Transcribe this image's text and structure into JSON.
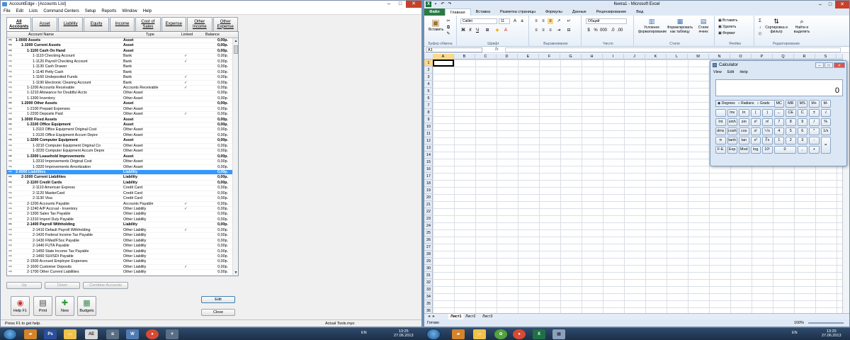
{
  "accountedge": {
    "title": "AccountEdge - [Accounts List]",
    "window_buttons": [
      "–",
      "□",
      "✕"
    ],
    "menu": [
      "File",
      "Edit",
      "Lists",
      "Command Centers",
      "Setup",
      "Reports",
      "Window",
      "Help"
    ],
    "tabs": [
      {
        "label": "All Accounts",
        "active": true
      },
      {
        "label": "Asset"
      },
      {
        "label": "Liability"
      },
      {
        "label": "Equity"
      },
      {
        "label": "Income"
      },
      {
        "label": "Cost of Sales"
      },
      {
        "label": "Expense"
      },
      {
        "label": "Other Income"
      },
      {
        "label": "Other Expense"
      }
    ],
    "columns": {
      "name": "Account Name",
      "type": "Type",
      "linked": "Linked",
      "balance": "Balance"
    },
    "rows": [
      {
        "name": "1-0000   Assets",
        "type": "Asset",
        "linked": "",
        "balance": "0,00p.",
        "level": 0,
        "bold": true
      },
      {
        "name": "1-1000   Current Assets",
        "type": "Asset",
        "linked": "",
        "balance": "0,00p.",
        "level": 1,
        "bold": true
      },
      {
        "name": "1-1100   Cash On Hand",
        "type": "Asset",
        "linked": "",
        "balance": "0,00p.",
        "level": 2,
        "bold": true
      },
      {
        "name": "1-1110      Checking Account",
        "type": "Bank",
        "linked": "✓",
        "balance": "0,00p.",
        "level": 3
      },
      {
        "name": "1-1120      Payroll Checking Account",
        "type": "Bank",
        "linked": "✓",
        "balance": "0,00p.",
        "level": 3
      },
      {
        "name": "1-1130      Cash Drawer",
        "type": "Bank",
        "linked": "",
        "balance": "0,00p.",
        "level": 3
      },
      {
        "name": "1-1140      Petty Cash",
        "type": "Bank",
        "linked": "",
        "balance": "0,00p.",
        "level": 3
      },
      {
        "name": "1-1160      Undeposited Funds",
        "type": "Bank",
        "linked": "✓",
        "balance": "0,00p.",
        "level": 3
      },
      {
        "name": "1-1190      Electronic Clearing Account",
        "type": "Bank",
        "linked": "✓",
        "balance": "0,00p.",
        "level": 3
      },
      {
        "name": "1-1200      Accounts Receivable",
        "type": "Accounts Receivable",
        "linked": "✓",
        "balance": "0,00p.",
        "level": 2
      },
      {
        "name": "1-1210      Allowance for Doubtful Accts",
        "type": "Other Asset",
        "linked": "",
        "balance": "0,00p.",
        "level": 2
      },
      {
        "name": "1-1300      Inventory",
        "type": "Other Asset",
        "linked": "",
        "balance": "0,00p.",
        "level": 2
      },
      {
        "name": "1-2000   Other Assets",
        "type": "Asset",
        "linked": "",
        "balance": "0,00p.",
        "level": 1,
        "bold": true
      },
      {
        "name": "1-2100      Prepaid Expenses",
        "type": "Other Asset",
        "linked": "",
        "balance": "0,00p.",
        "level": 2
      },
      {
        "name": "1-2200      Deposits Paid",
        "type": "Other Asset",
        "linked": "✓",
        "balance": "0,00p.",
        "level": 2
      },
      {
        "name": "1-3000   Fixed Assets",
        "type": "Asset",
        "linked": "",
        "balance": "0,00p.",
        "level": 1,
        "bold": true
      },
      {
        "name": "1-3100   Office Equipment",
        "type": "Asset",
        "linked": "",
        "balance": "0,00p.",
        "level": 2,
        "bold": true
      },
      {
        "name": "1-3110      Office Equipment Original Cost",
        "type": "Other Asset",
        "linked": "",
        "balance": "0,00p.",
        "level": 3
      },
      {
        "name": "1-3120      Office Equipment Accum Depre",
        "type": "Other Asset",
        "linked": "",
        "balance": "0,00p.",
        "level": 3
      },
      {
        "name": "1-3200   Computer Equipment",
        "type": "Asset",
        "linked": "",
        "balance": "0,00p.",
        "level": 2,
        "bold": true
      },
      {
        "name": "1-3210      Computer Equipment Original Co",
        "type": "Other Asset",
        "linked": "",
        "balance": "0,00p.",
        "level": 3
      },
      {
        "name": "1-3220      Computer Equipment Accum Depre",
        "type": "Other Asset",
        "linked": "",
        "balance": "0,00p.",
        "level": 3
      },
      {
        "name": "1-3300   Leasehold Improvements",
        "type": "Asset",
        "linked": "",
        "balance": "0,00p.",
        "level": 2,
        "bold": true
      },
      {
        "name": "1-3310      Improvements Original Cost",
        "type": "Other Asset",
        "linked": "",
        "balance": "0,00p.",
        "level": 3
      },
      {
        "name": "1-3320      Improvements Amortization",
        "type": "Other Asset",
        "linked": "",
        "balance": "0,00p.",
        "level": 3
      },
      {
        "name": "2-0000   Liabilities",
        "type": "Liability",
        "linked": "",
        "balance": "0,00p.",
        "level": 0,
        "bold": true,
        "selected": true
      },
      {
        "name": "2-1000   Current Liabilities",
        "type": "Liability",
        "linked": "",
        "balance": "0,00p.",
        "level": 1,
        "bold": true
      },
      {
        "name": "2-1100   Credit Cards",
        "type": "Liability",
        "linked": "",
        "balance": "0,00p.",
        "level": 2,
        "bold": true
      },
      {
        "name": "2-1110      American Express",
        "type": "Credit Card",
        "linked": "",
        "balance": "0,00p.",
        "level": 3
      },
      {
        "name": "2-1120      MasterCard",
        "type": "Credit Card",
        "linked": "",
        "balance": "0,00p.",
        "level": 3
      },
      {
        "name": "2-1130      Visa",
        "type": "Credit Card",
        "linked": "",
        "balance": "0,00p.",
        "level": 3
      },
      {
        "name": "2-1200      Accounts Payable",
        "type": "Accounts Payable",
        "linked": "✓",
        "balance": "0,00p.",
        "level": 2
      },
      {
        "name": "2-1240      A/P Accrual - Inventory",
        "type": "Other Liability",
        "linked": "✓",
        "balance": "0,00p.",
        "level": 2
      },
      {
        "name": "2-1300      Sales Tax Payable",
        "type": "Other Liability",
        "linked": "",
        "balance": "0,00p.",
        "level": 2
      },
      {
        "name": "2-1310      Import Duty Payable",
        "type": "Other Liability",
        "linked": "",
        "balance": "0,00p.",
        "level": 2
      },
      {
        "name": "2-1400   Payroll Withholding",
        "type": "Liability",
        "linked": "",
        "balance": "0,00p.",
        "level": 2,
        "bold": true
      },
      {
        "name": "2-1410      Default Payroll Withholding",
        "type": "Other Liability",
        "linked": "✓",
        "balance": "0,00p.",
        "level": 3
      },
      {
        "name": "2-1420      Federal Income Tax Payable",
        "type": "Other Liability",
        "linked": "",
        "balance": "0,00p.",
        "level": 3
      },
      {
        "name": "2-1430      FMed/FSoc Payable",
        "type": "Other Liability",
        "linked": "",
        "balance": "0,00p.",
        "level": 3
      },
      {
        "name": "2-1440      FUTA Payable",
        "type": "Other Liability",
        "linked": "",
        "balance": "0,00p.",
        "level": 3
      },
      {
        "name": "2-1450      State Income Tax Payable",
        "type": "Other Liability",
        "linked": "",
        "balance": "0,00p.",
        "level": 3
      },
      {
        "name": "2-1460      SUI/SDI Payable",
        "type": "Other Liability",
        "linked": "",
        "balance": "0,00p.",
        "level": 3
      },
      {
        "name": "2-1500      Accrued Employer Expenses",
        "type": "Other Liability",
        "linked": "",
        "balance": "0,00p.",
        "level": 2
      },
      {
        "name": "2-1600      Customer Deposits",
        "type": "Other Liability",
        "linked": "✓",
        "balance": "0,00p.",
        "level": 2
      },
      {
        "name": "2-1700      Other Current Liabilities",
        "type": "Other Liability",
        "linked": "",
        "balance": "0,00p.",
        "level": 2
      }
    ],
    "buttons": {
      "up": "Up",
      "down": "Down",
      "combine": "Combine Accounts",
      "edit": "Edit",
      "close": "Close"
    },
    "toolbar": [
      {
        "label": "Help F1",
        "icon": "lifebuoy-icon",
        "glyph": "◉"
      },
      {
        "label": "Print",
        "icon": "printer-icon",
        "glyph": "▤"
      },
      {
        "label": "New",
        "icon": "plus-icon",
        "glyph": "✚"
      },
      {
        "label": "Budgets",
        "icon": "budget-icon",
        "glyph": "▦"
      }
    ],
    "status_left": "Press F1 to get help.",
    "status_right": "Actual Tools.myo"
  },
  "excel": {
    "title": "Книга1 - Microsoft Excel",
    "tabs": [
      "Файл",
      "Главная",
      "Вставка",
      "Разметка страницы",
      "Формулы",
      "Данные",
      "Рецензирование",
      "Вид"
    ],
    "active_tab": "Главная",
    "ribbon": {
      "paste": "Вставить",
      "font_name": "Calibri",
      "font_size": "11",
      "number_format": "Общий",
      "cond_format": "Условное форматирование",
      "format_table": "Форматировать как таблицу",
      "cell_styles": "Стили ячеек",
      "insert": "Вставить",
      "delete": "Удалить",
      "format": "Формат",
      "sort_filter": "Сортировка и фильтр",
      "find_select": "Найти и выделить",
      "groups": [
        "Буфер обмена",
        "Шрифт",
        "Выравнивание",
        "Число",
        "Стили",
        "Ячейки",
        "Редактирование"
      ]
    },
    "name_box": "A1",
    "fx": "fx",
    "columns": [
      "A",
      "B",
      "C",
      "D",
      "E",
      "F",
      "G",
      "H",
      "I",
      "J",
      "K",
      "L",
      "M",
      "N",
      "O",
      "P",
      "Q",
      "R",
      "S"
    ],
    "rows": [
      "1",
      "2",
      "3",
      "4",
      "5",
      "6",
      "7",
      "8",
      "9",
      "10",
      "11",
      "12",
      "13",
      "14",
      "15",
      "16",
      "17",
      "18",
      "19",
      "20",
      "21",
      "22",
      "23",
      "24",
      "25",
      "26",
      "27",
      "28",
      "29",
      "30",
      "31",
      "32",
      "33",
      "34",
      "35",
      "36"
    ],
    "sheets": [
      "Лист1",
      "Лист2",
      "Лист3"
    ],
    "status": "Готово",
    "zoom": "100%"
  },
  "calculator": {
    "title": "Calculator",
    "menu": [
      "View",
      "Edit",
      "Help"
    ],
    "display": "0",
    "modes": [
      "Degrees",
      "Radians",
      "Grads"
    ],
    "keys": [
      [
        "",
        "Inv",
        "ln",
        "(",
        ")",
        "←",
        "CE",
        "C",
        "±",
        "√"
      ],
      [
        "Int",
        "sinh",
        "sin",
        "x²",
        "n!",
        "7",
        "8",
        "9",
        "/",
        "%"
      ],
      [
        "dms",
        "cosh",
        "cos",
        "xʸ",
        "ʸ√x",
        "4",
        "5",
        "6",
        "*",
        "1/x"
      ],
      [
        "π",
        "tanh",
        "tan",
        "x³",
        "∛x",
        "1",
        "2",
        "3",
        "-",
        "="
      ],
      [
        "F-E",
        "Exp",
        "Mod",
        "log",
        "10ˣ",
        "0",
        ",",
        "+"
      ]
    ],
    "memory": [
      "MC",
      "MR",
      "MS",
      "M+",
      "M-"
    ]
  },
  "taskbar": {
    "left_lang": "EN",
    "left_time": "13:25",
    "left_date": "27.06.2013",
    "right_lang": "EN",
    "right_time": "13:25",
    "right_date": "27.06.2013"
  }
}
